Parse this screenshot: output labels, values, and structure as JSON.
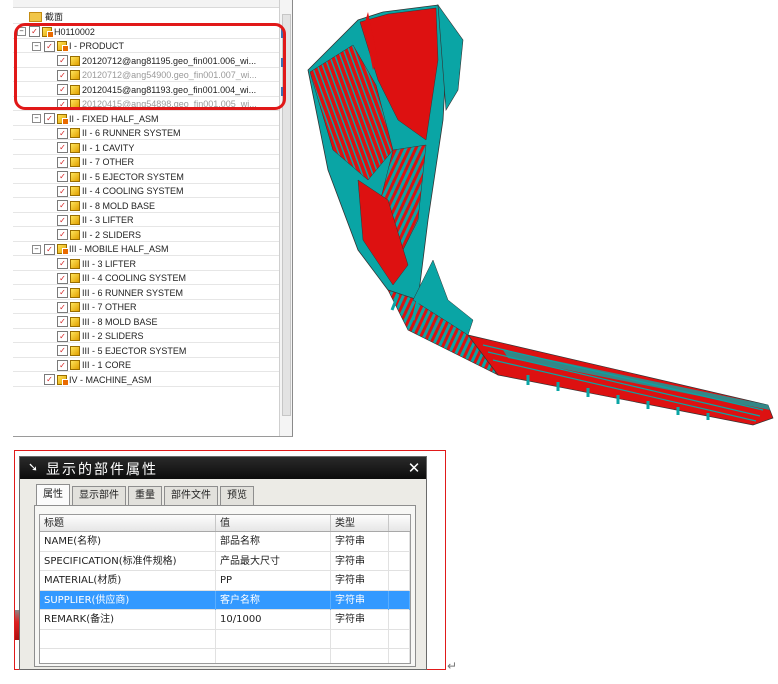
{
  "navigator": {
    "section_header": "截面",
    "root": "H0110002",
    "nodes": [
      {
        "label": "I - PRODUCT",
        "level": 1,
        "type": "asm",
        "expander": "⊟",
        "dim": false
      },
      {
        "label": "20120712@ang81195.geo_fin001.006_wi...",
        "level": 2,
        "type": "part",
        "dim": false
      },
      {
        "label": "20120712@ang54900.geo_fin001.007_wi...",
        "level": 2,
        "type": "part",
        "dim": true
      },
      {
        "label": "20120415@ang81193.geo_fin001.004_wi...",
        "level": 2,
        "type": "part",
        "dim": false
      },
      {
        "label": "20120415@ang54898.geo_fin001.005_wi...",
        "level": 2,
        "type": "part",
        "dim": true
      },
      {
        "label": "II - FIXED HALF_ASM",
        "level": 1,
        "type": "asm",
        "expander": "⊟",
        "dim": false
      },
      {
        "label": "II - 6 RUNNER SYSTEM",
        "level": 2,
        "type": "part",
        "dim": false
      },
      {
        "label": "II - 1 CAVITY",
        "level": 2,
        "type": "part",
        "dim": false
      },
      {
        "label": "II - 7 OTHER",
        "level": 2,
        "type": "part",
        "dim": false
      },
      {
        "label": "II - 5 EJECTOR SYSTEM",
        "level": 2,
        "type": "part",
        "dim": false
      },
      {
        "label": "II - 4 COOLING SYSTEM",
        "level": 2,
        "type": "part",
        "dim": false
      },
      {
        "label": "II - 8 MOLD BASE",
        "level": 2,
        "type": "part",
        "dim": false
      },
      {
        "label": "II - 3 LIFTER",
        "level": 2,
        "type": "part",
        "dim": false
      },
      {
        "label": "II - 2 SLIDERS",
        "level": 2,
        "type": "part",
        "dim": false
      },
      {
        "label": "III - MOBILE HALF_ASM",
        "level": 1,
        "type": "asm",
        "expander": "⊟",
        "dim": false
      },
      {
        "label": "III - 3 LIFTER",
        "level": 2,
        "type": "part",
        "dim": false
      },
      {
        "label": "III - 4 COOLING SYSTEM",
        "level": 2,
        "type": "part",
        "dim": false
      },
      {
        "label": "III - 6 RUNNER SYSTEM",
        "level": 2,
        "type": "part",
        "dim": false
      },
      {
        "label": "III - 7 OTHER",
        "level": 2,
        "type": "part",
        "dim": false
      },
      {
        "label": "III - 8 MOLD BASE",
        "level": 2,
        "type": "part",
        "dim": false
      },
      {
        "label": "III - 2 SLIDERS",
        "level": 2,
        "type": "part",
        "dim": false
      },
      {
        "label": "III - 5 EJECTOR SYSTEM",
        "level": 2,
        "type": "part",
        "dim": false
      },
      {
        "label": "III - 1 CORE",
        "level": 2,
        "type": "part",
        "dim": false
      },
      {
        "label": "IV - MACHINE_ASM",
        "level": 1,
        "type": "asm",
        "expander": "",
        "dim": false
      }
    ]
  },
  "dialog": {
    "title": "显示的部件属性",
    "tabs": [
      "属性",
      "显示部件",
      "重量",
      "部件文件",
      "预览"
    ],
    "active_tab": "属性",
    "columns": [
      "标题",
      "值",
      "类型"
    ],
    "rows": [
      {
        "title": "NAME(名称)",
        "value": "部品名称",
        "type": "字符串",
        "selected": false
      },
      {
        "title": "SPECIFICATION(标准件规格)",
        "value": "产品最大尺寸",
        "type": "字符串",
        "selected": false
      },
      {
        "title": "MATERIAL(材质)",
        "value": "PP",
        "type": "字符串",
        "selected": false
      },
      {
        "title": "SUPPLIER(供应商)",
        "value": "客户名称",
        "type": "字符串",
        "selected": true
      },
      {
        "title": "REMARK(备注)",
        "value": "10/1000",
        "type": "字符串",
        "selected": false
      }
    ]
  },
  "colors": {
    "highlight_red": "#e11818",
    "model_red": "#dd1111",
    "model_teal": "#0aa5a5",
    "selection_blue": "#3399ff",
    "checkmark_red": "#d42020"
  }
}
